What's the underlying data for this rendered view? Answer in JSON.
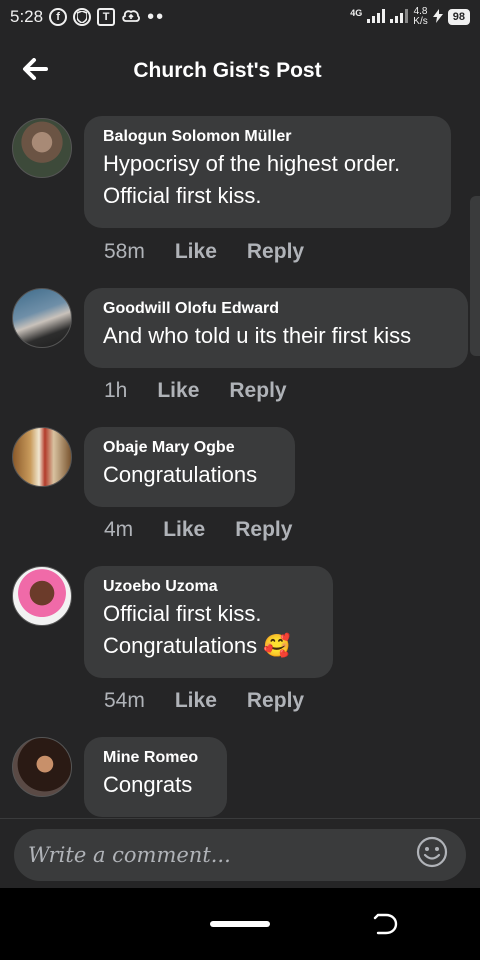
{
  "status_bar": {
    "time": "5:28",
    "network": "4G",
    "speed_value": "4.8",
    "speed_unit": "K/s",
    "battery": "98"
  },
  "header": {
    "title": "Church Gist's Post"
  },
  "comments": [
    {
      "author": "Balogun Solomon Müller",
      "text_lines": [
        "Hypocrisy of the highest order.",
        "Official first kiss."
      ],
      "time": "58m",
      "like": "Like",
      "reply": "Reply"
    },
    {
      "author": "Goodwill Olofu Edward",
      "text_lines": [
        "And who told u its their first kiss"
      ],
      "time": "1h",
      "like": "Like",
      "reply": "Reply"
    },
    {
      "author": "Obaje Mary Ogbe",
      "text_lines": [
        "Congratulations"
      ],
      "time": "4m",
      "like": "Like",
      "reply": "Reply"
    },
    {
      "author": "Uzoebo Uzoma",
      "text_lines": [
        "Official first kiss.",
        "Congratulations 🥰"
      ],
      "time": "54m",
      "like": "Like",
      "reply": "Reply"
    },
    {
      "author": "Mine Romeo",
      "text_lines": [
        "Congrats"
      ]
    }
  ],
  "composer": {
    "placeholder": "Write a comment..."
  },
  "icons": {
    "back": "back-arrow-icon",
    "emoji": "emoji-smile-icon"
  }
}
